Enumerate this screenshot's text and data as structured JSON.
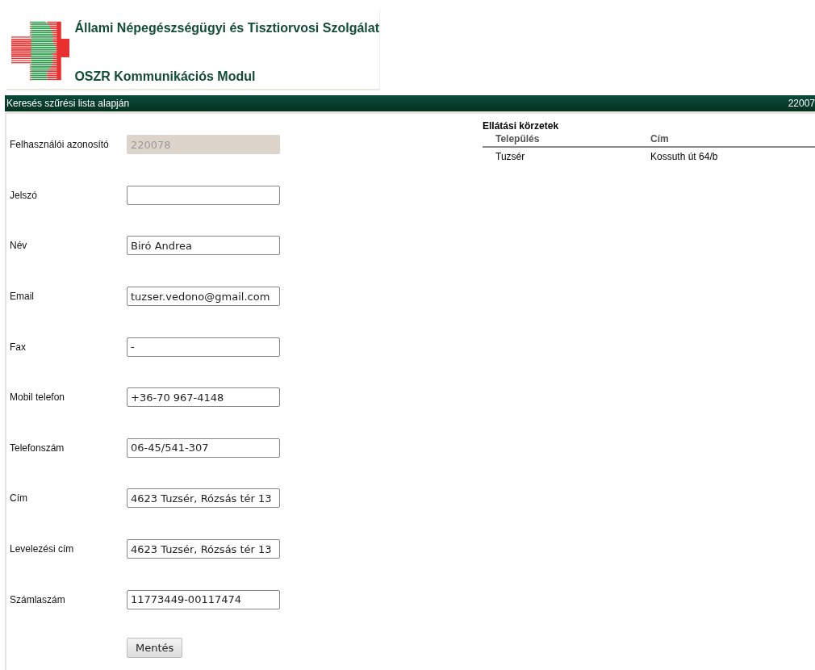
{
  "header": {
    "org_name": "Állami Népegészségügyi és Tisztiorvosi Szolgálat",
    "module_name": "OSZR Kommunikációs Modul"
  },
  "nav_bar": {
    "title": "Keresés szűrési lista alapján",
    "user_id": "22007"
  },
  "form": {
    "fields": [
      {
        "label": "Felhasználói azonosító",
        "value": "220078",
        "disabled": true
      },
      {
        "label": "Jelszó",
        "disabled": false
      },
      {
        "label": "Név",
        "value": "Biró Andrea",
        "disabled": false
      },
      {
        "label": "Email",
        "value": "tuzser.vedono@gmail.com",
        "disabled": false
      },
      {
        "label": "Fax",
        "value": "-",
        "disabled": false
      },
      {
        "label": "Mobil telefon",
        "value": "+36-70 967-4148",
        "disabled": false
      },
      {
        "label": "Telefonszám",
        "value": "06-45/541-307",
        "disabled": false
      },
      {
        "label": "Cím",
        "value": "4623 Tuzsér, Rózsás tér 13",
        "disabled": false
      },
      {
        "label": "Levelezési cím",
        "value": "4623 Tuzsér, Rózsás tér 13",
        "disabled": false
      },
      {
        "label": "Számlaszám",
        "value": "11773449-00117474",
        "disabled": false
      }
    ],
    "save_button": "Mentés"
  },
  "districts": {
    "title": "Ellátási körzetek",
    "columns": [
      "Település",
      "Cím"
    ],
    "rows": [
      [
        "Tuzsér",
        "Kossuth út 64/b"
      ]
    ]
  }
}
